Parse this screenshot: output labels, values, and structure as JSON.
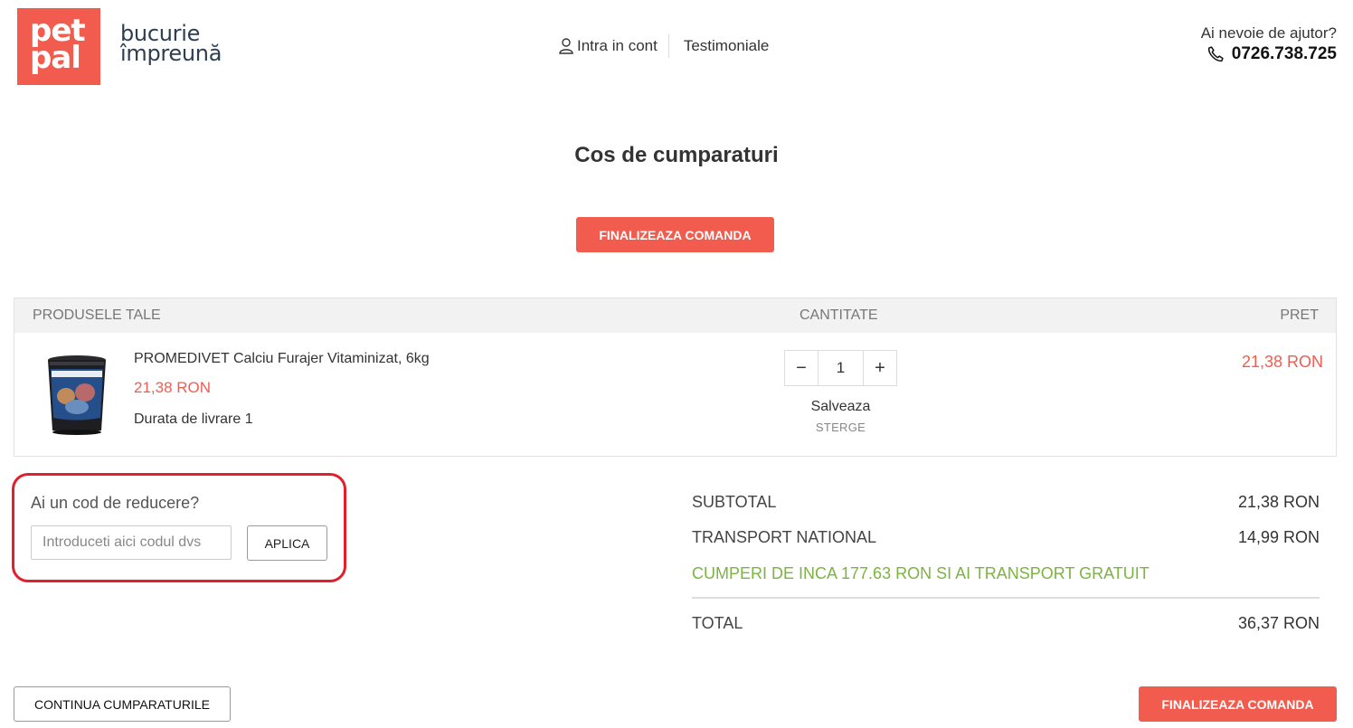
{
  "brand": {
    "logo_line1": "pet",
    "logo_line2": "pal",
    "tagline_line1": "bucurie",
    "tagline_line2": "împreună",
    "accent_color": "#f25c4f"
  },
  "nav": {
    "login_label": "Intra in cont",
    "testimonials_label": "Testimoniale",
    "login_icon": "user-icon"
  },
  "help": {
    "question": "Ai nevoie de ajutor?",
    "phone": "0726.738.725",
    "phone_icon": "phone-icon"
  },
  "page_title": "Cos de cumparaturi",
  "checkout_label": "FINALIZEAZA COMANDA",
  "cart": {
    "headers": {
      "products": "PRODUSELE TALE",
      "quantity": "CANTITATE",
      "price": "PRET"
    },
    "items": [
      {
        "name": "PROMEDIVET Calciu Furajer Vitaminizat, 6kg",
        "unit_price": "21,38 RON",
        "delivery": "Durata de livrare 1",
        "quantity": "1",
        "save_label": "Salveaza",
        "delete_label": "STERGE",
        "total_price": "21,38 RON"
      }
    ]
  },
  "discount": {
    "label": "Ai un cod de reducere?",
    "placeholder": "Introduceti aici codul dvs",
    "apply_label": "APLICA",
    "highlight_color": "#e0202a"
  },
  "totals": {
    "subtotal_label": "SUBTOTAL",
    "subtotal_value": "21,38 RON",
    "shipping_label": "TRANSPORT NATIONAL",
    "shipping_value": "14,99 RON",
    "free_shipping_msg": "CUMPERI DE INCA 177.63 RON SI AI TRANSPORT GRATUIT",
    "total_label": "TOTAL",
    "total_value": "36,37 RON",
    "free_msg_color": "#7cb342"
  },
  "continue_label": "CONTINUA CUMPARATURILE"
}
